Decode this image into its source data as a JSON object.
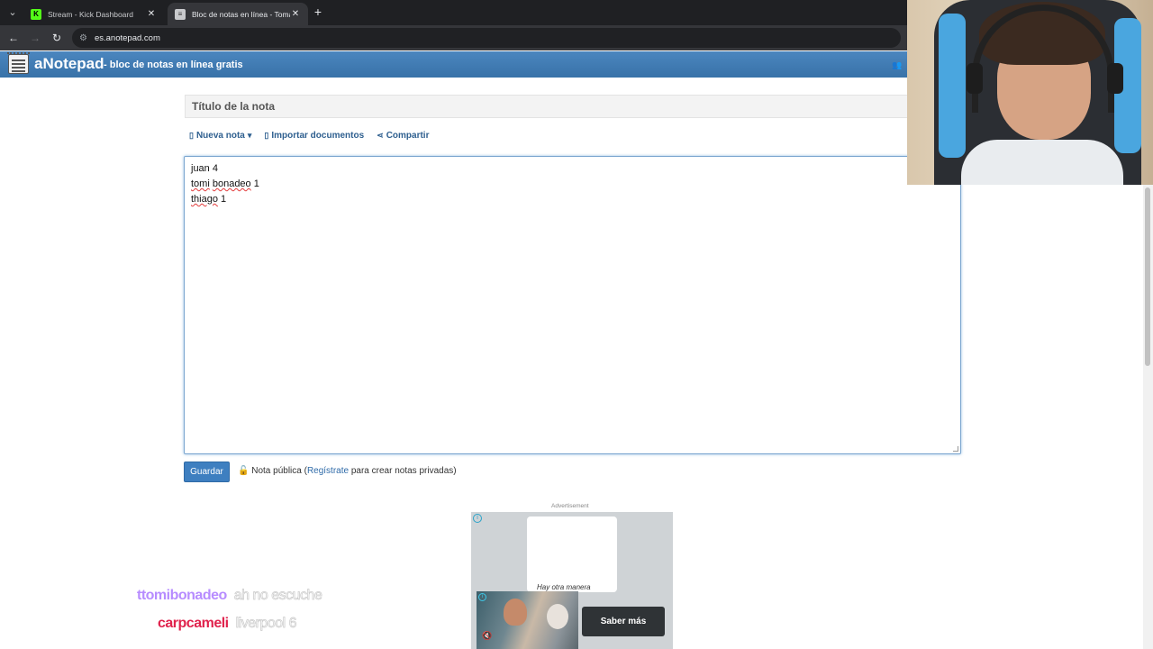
{
  "browser": {
    "tabs": [
      {
        "title": "Stream - Kick Dashboard",
        "favicon": "kick-icon",
        "active": false
      },
      {
        "title": "Bloc de notas en línea - Toma y",
        "favicon": "notepad-icon",
        "active": true
      }
    ],
    "url": "es.anotepad.com"
  },
  "site": {
    "brand": "aNotepad",
    "tagline": "- bloc de notas en línea gratis"
  },
  "note": {
    "title_placeholder": "Título de la nota",
    "toolbar": {
      "new_note": "Nueva nota",
      "import_docs": "Importar documentos",
      "share": "Compartir"
    },
    "lines": {
      "line1_word": "juan",
      "line1_num": " 4",
      "line2_word1": "tomi",
      "line2_sp": " ",
      "line2_word2": "bonadeo",
      "line2_num": " 1",
      "line3_word": "thiago",
      "line3_num": " 1"
    },
    "save_label": "Guardar",
    "public_prefix": "Nota pública (",
    "register_link": "Regístrate",
    "public_suffix": " para crear notas privadas)"
  },
  "ad": {
    "label": "Advertisement",
    "card_text": "Hay otra manera",
    "cta": "Saber más"
  },
  "chat": [
    {
      "user": "ttomibonadeo",
      "message": "ah no escuche"
    },
    {
      "user": "carpcameli",
      "message": "liverpool 6"
    }
  ],
  "colors": {
    "header_blue": "#3872a8",
    "link_blue": "#2e6aa8",
    "kick_green": "#53fc18"
  }
}
